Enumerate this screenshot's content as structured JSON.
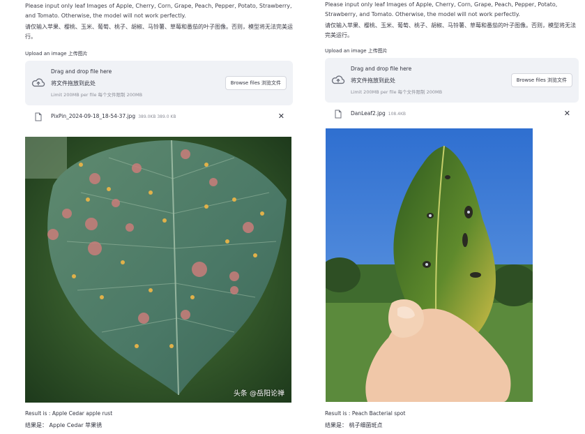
{
  "left": {
    "instructions_en": "Please input only leaf Images of Apple, Cherry, Corn, Grape, Peach, Pepper, Potato, Strawberry, and Tomato. Otherwise, the model will not work perfectly.",
    "instructions_zh": "请仅输入苹果、樱桃、玉米、葡萄、桃子、胡椒、马铃薯、草莓和番茄的叶子图像。否则，模型将无法完美运行。",
    "upload_label": "Upload an image 上传图片",
    "dropzone": {
      "drag_text": "Drag and drop file here",
      "drag_text_zh": "将文件拖放到此处",
      "limit_text": "Limit 200MB per file 每个文件限制 200MB",
      "browse_label": "Browse files 浏览文件",
      "upload_icon": "cloud-upload-icon"
    },
    "file": {
      "name": "PixPin_2024-09-18_18-54-37.jpg",
      "size": "389.0KB 389.0 KB",
      "close_symbol": "✕"
    },
    "watermark": "头条 @岳阳论禅",
    "result_en": "Result is : Apple Cedar apple rust",
    "result_zh": "结果是： Apple Cedar 苹果锈"
  },
  "right": {
    "instructions_en": "Please input only leaf Images of Apple, Cherry, Corn, Grape, Peach, Pepper, Potato, Strawberry, and Tomato. Otherwise, the model will not work perfectly.",
    "instructions_zh": "请仅输入苹果、樱桃、玉米、葡萄、桃子、胡椒、马铃薯、草莓和番茄的叶子图像。否则，模型将无法完美运行。",
    "upload_label": "Upload an image 上传图片",
    "dropzone": {
      "drag_text": "Drag and drop file here",
      "drag_text_zh": "将文件拖放到此处",
      "limit_text": "Limit 200MB per file 每个文件限制 200MB",
      "browse_label": "Browse files 浏览文件",
      "upload_icon": "cloud-upload-icon"
    },
    "file": {
      "name": "DanLeaf2.jpg",
      "size": "108.4KB",
      "close_symbol": "✕"
    },
    "result_en": "Result is : Peach Bacterial spot",
    "result_zh": "结果是： 桃子细菌斑点"
  },
  "colors": {
    "dropzone_bg": "#f0f2f6",
    "text": "#31333f",
    "muted": "#8b8d97"
  }
}
